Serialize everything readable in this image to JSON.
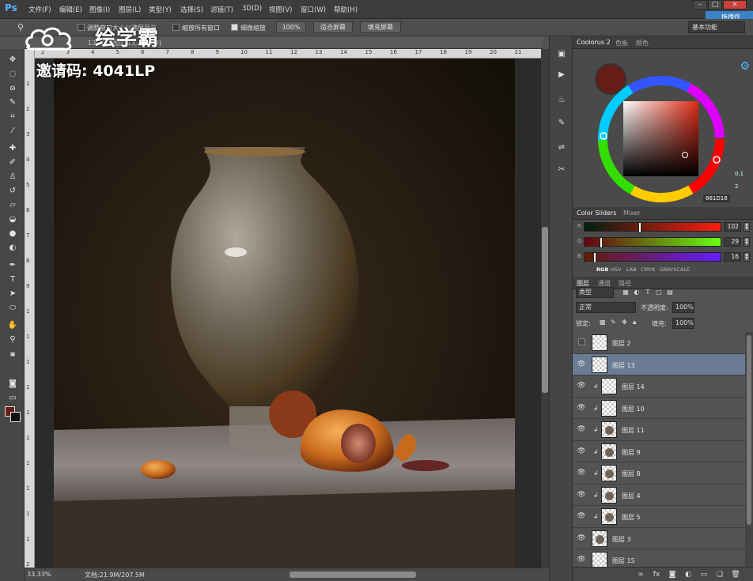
{
  "app": {
    "logo": "Ps",
    "menus": [
      "文件(F)",
      "编辑(E)",
      "图像(I)",
      "图层(L)",
      "类型(Y)",
      "选择(S)",
      "滤镜(T)",
      "3D(D)",
      "视图(V)",
      "窗口(W)",
      "帮助(H)"
    ],
    "cloud_badge": "拖拽作"
  },
  "options_bar": {
    "tool_icon": "zoom-icon",
    "resize_windows_label": "调整窗口大小以满屏显示",
    "zoom_all_label": "缩放所有窗口",
    "scrubby_zoom_label": "细微缩放",
    "zoom_100_label": "100%",
    "fit_screen_label": "适合屏幕",
    "fill_screen_label": "填充屏幕",
    "workspace": "基本功能"
  },
  "watermark": {
    "brand": "绘学霸",
    "invite_code": "邀请码: 4041LP"
  },
  "document": {
    "tab_label": "13.3% (图层 13, RGB/8)",
    "ruler_numbers": [
      "2",
      "3",
      "4",
      "5",
      "6",
      "7",
      "8",
      "9",
      "10",
      "11",
      "12",
      "13",
      "14",
      "15",
      "16",
      "17",
      "18",
      "19",
      "20",
      "21"
    ],
    "ruler_left_numbers": [
      "1",
      "2",
      "3",
      "4",
      "5",
      "6",
      "7",
      "8",
      "9",
      "1",
      "1",
      "1",
      "1",
      "1",
      "1",
      "1",
      "1",
      "1",
      "1",
      "2"
    ],
    "zoom": "33.33%",
    "doc_size": "文档:21.9M/207.5M"
  },
  "coolorus": {
    "tabs": [
      "Coolorus 2",
      "色板",
      "颜色"
    ],
    "hex": "661D18",
    "side_values": [
      "0.1",
      "2"
    ],
    "current_color": "#661d18"
  },
  "color_sliders": {
    "tabs": [
      "Color Sliders",
      "Mixer"
    ],
    "rows": [
      {
        "letter": "R",
        "value": "102",
        "fraction": 0.4
      },
      {
        "letter": "G",
        "value": "29",
        "fraction": 0.114
      },
      {
        "letter": "B",
        "value": "16",
        "fraction": 0.063
      }
    ],
    "modes": [
      "RGB",
      "HSV",
      "LAB",
      "CMYK",
      "GRAYSCALE"
    ],
    "active_mode": "RGB"
  },
  "layers": {
    "tabs": [
      "图层",
      "通道",
      "路径"
    ],
    "filter_kind": "类型",
    "blend_mode": "正常",
    "opacity_label": "不透明度:",
    "opacity_value": "100%",
    "lock_label": "锁定:",
    "fill_label": "填充:",
    "fill_value": "100%",
    "items": [
      {
        "name": "图层 2",
        "visible": false,
        "clipped": false,
        "selected": false,
        "mark": false
      },
      {
        "name": "图层 13",
        "visible": true,
        "clipped": false,
        "selected": true,
        "mark": false
      },
      {
        "name": "图层 14",
        "visible": true,
        "clipped": true,
        "selected": false,
        "mark": false
      },
      {
        "name": "图层 10",
        "visible": true,
        "clipped": true,
        "selected": false,
        "mark": false
      },
      {
        "name": "图层 11",
        "visible": true,
        "clipped": true,
        "selected": false,
        "mark": true
      },
      {
        "name": "图层 9",
        "visible": true,
        "clipped": true,
        "selected": false,
        "mark": true
      },
      {
        "name": "图层 8",
        "visible": true,
        "clipped": true,
        "selected": false,
        "mark": true
      },
      {
        "name": "图层 4",
        "visible": true,
        "clipped": true,
        "selected": false,
        "mark": true
      },
      {
        "name": "图层 5",
        "visible": true,
        "clipped": true,
        "selected": false,
        "mark": true
      },
      {
        "name": "图层 3",
        "visible": true,
        "clipped": false,
        "selected": false,
        "mark": true
      },
      {
        "name": "图层 15",
        "visible": true,
        "clipped": false,
        "selected": false,
        "mark": false
      }
    ]
  },
  "colors": {
    "foreground": "#661d18",
    "background": "#111111",
    "selected_layer": "#6a7b94",
    "accent": "#4cb4ff"
  }
}
